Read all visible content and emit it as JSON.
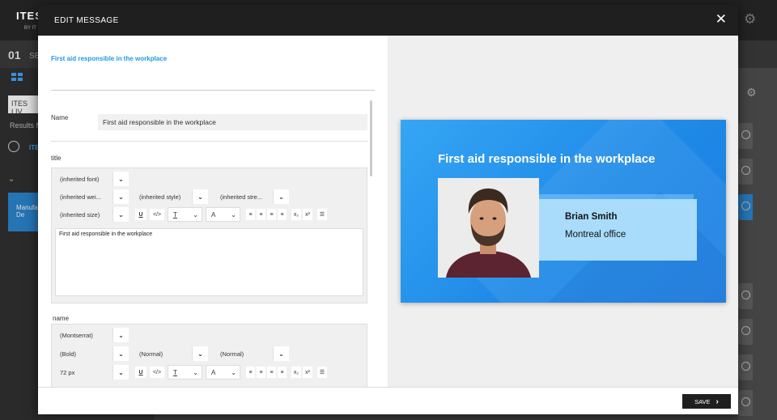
{
  "background_app": {
    "logo": "ITES",
    "logo_sub": "BY IT",
    "step_number": "01",
    "step_text": "SE",
    "live_button": "ITES LIV",
    "results_text": "Results f",
    "item_text": "ITE",
    "card_text": "Manufa De"
  },
  "modal": {
    "title": "EDIT MESSAGE",
    "close_label": "✕",
    "message_heading": "First aid responsible in the workplace",
    "name_label": "Name",
    "name_value": "First aid responsible in the workplace",
    "save_label": "SAVE"
  },
  "title_section": {
    "label": "title",
    "font": "(inherited font)",
    "weight": "(inherited wei...",
    "style": "(inherited style)",
    "stretch": "(inherited stre...",
    "size": "(inherited size)",
    "text": "First aid responsible in the workplace"
  },
  "name_section": {
    "label": "name",
    "font": "(Montserrat)",
    "weight": "(Bold)",
    "style": "(Normal)",
    "stretch": "(Normal)",
    "size": "72 px"
  },
  "toolbar": {
    "underline": "U",
    "code": "</>",
    "text_color": "T",
    "highlight": "A",
    "subscript": "x₂",
    "superscript": "x²"
  },
  "preview": {
    "title": "First aid responsible in the workplace",
    "person_name": "Brian Smith",
    "person_office": "Montreal office"
  },
  "colors": {
    "accent": "#1e9be0",
    "preview_bg": "#2690ec",
    "modal_header": "#1f1f1f"
  }
}
